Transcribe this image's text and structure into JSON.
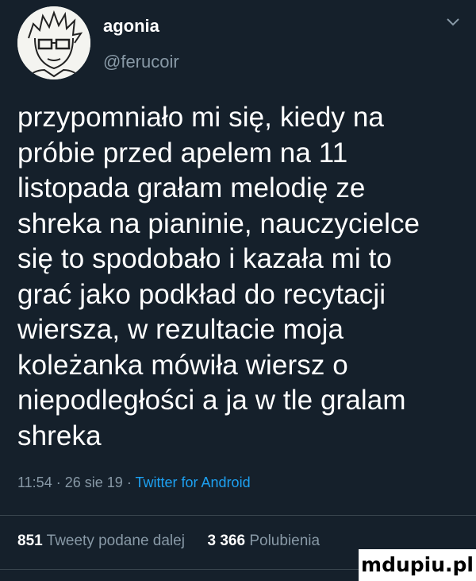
{
  "author": {
    "display_name": "agonia",
    "handle": "@ferucoir",
    "avatar_icon": "sketch-portrait-avatar",
    "menu_icon": "chevron-down-icon"
  },
  "tweet": {
    "lines": [
      "przypomniało mi się, kiedy na",
      "próbie przed apelem na 11",
      "listopada grałam melodię ze",
      "shreka na pianinie, nauczycielce",
      "się to spodobało i kazała mi to",
      "grać jako podkład do recytacji",
      "wiersza, w rezultacie moja",
      "koleżanka mówiła wiersz o",
      "niepodległości a ja w tle gralam",
      "shreka"
    ]
  },
  "meta": {
    "time": "11:54",
    "separator": "·",
    "date": "26 sie 19",
    "source": "Twitter for Android"
  },
  "stats": {
    "retweets_count": "851",
    "retweets_label": "Tweety podane dalej",
    "likes_count": "3 366",
    "likes_label": "Polubienia"
  },
  "watermark": "mdupiu.pl",
  "colors": {
    "background": "#15202b",
    "text": "#ffffff",
    "secondary": "#8899a6",
    "link": "#1da1f2"
  }
}
